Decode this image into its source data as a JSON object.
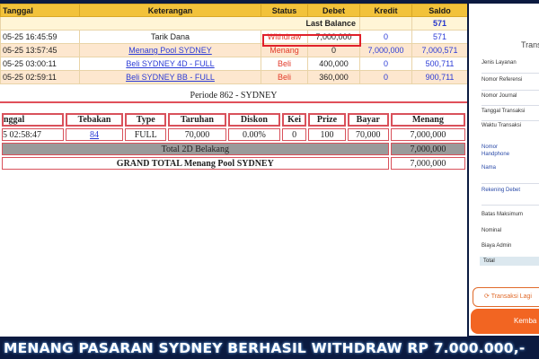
{
  "ledger": {
    "headers": [
      "Tanggal",
      "Keterangan",
      "Status",
      "Debet",
      "Kredit",
      "Saldo"
    ],
    "last_balance_label": "Last Balance",
    "last_balance_value": "571",
    "rows": [
      {
        "tanggal": "05-25 16:45:59",
        "keterangan": "Tarik Dana",
        "status": "Withdraw",
        "debet": "7,000,000",
        "kredit": "0",
        "saldo": "571"
      },
      {
        "tanggal": "05-25 13:57:45",
        "keterangan": "Menang Pool SYDNEY",
        "status": "Menang",
        "debet": "0",
        "kredit": "7,000,000",
        "saldo": "7,000,571"
      },
      {
        "tanggal": "05-25 03:00:11",
        "keterangan": "Beli SYDNEY 4D - FULL",
        "status": "Beli",
        "debet": "400,000",
        "kredit": "0",
        "saldo": "500,711"
      },
      {
        "tanggal": "05-25 02:59:11",
        "keterangan": "Beli SYDNEY BB - FULL",
        "status": "Beli",
        "debet": "360,000",
        "kredit": "0",
        "saldo": "900,711"
      }
    ]
  },
  "periode": {
    "title": "Periode 862 - SYDNEY",
    "headers": [
      "nggal",
      "Tebakan",
      "Type",
      "Taruhan",
      "Diskon",
      "Kei",
      "Prize",
      "Bayar",
      "Menang"
    ],
    "row": {
      "tanggal": "5 02:58:47",
      "tebakan": "84",
      "type": "FULL",
      "taruhan": "70,000",
      "diskon": "0.00%",
      "kei": "0",
      "prize": "100",
      "bayar": "70,000",
      "menang": "7,000,000"
    },
    "subtotal_label": "Total 2D Belakang",
    "subtotal_value": "7,000,000",
    "grand_label": "GRAND TOTAL  Menang Pool SYDNEY",
    "grand_value": "7,000,000"
  },
  "side": {
    "title": "Trans",
    "fields": [
      "Jenis Layanan",
      "Nomor Referensi",
      "Nomor Journal",
      "Tanggal Transaksi",
      "Waktu Transaksi"
    ],
    "handphone_label": "Nomor Handphone",
    "nama_label": "Nama",
    "rekening_label": "Rekening Debet",
    "limit_fields": [
      "Batas Maksimum",
      "Nominal",
      "Biaya Admin"
    ],
    "total_label": "Total",
    "btn_again": "Transaksi Lagi",
    "btn_back": "Kemba"
  },
  "banner": {
    "text": "MENANG PASARAN SYDNEY BERHASIL WITHDRAW RP 7.000.000,-"
  },
  "colors": {
    "header_yellow": "#f2c23a",
    "accent_red": "#e0202a",
    "link_blue": "#2b3bd6",
    "orange": "#f26522",
    "banner_navy": "#0b1a40"
  }
}
